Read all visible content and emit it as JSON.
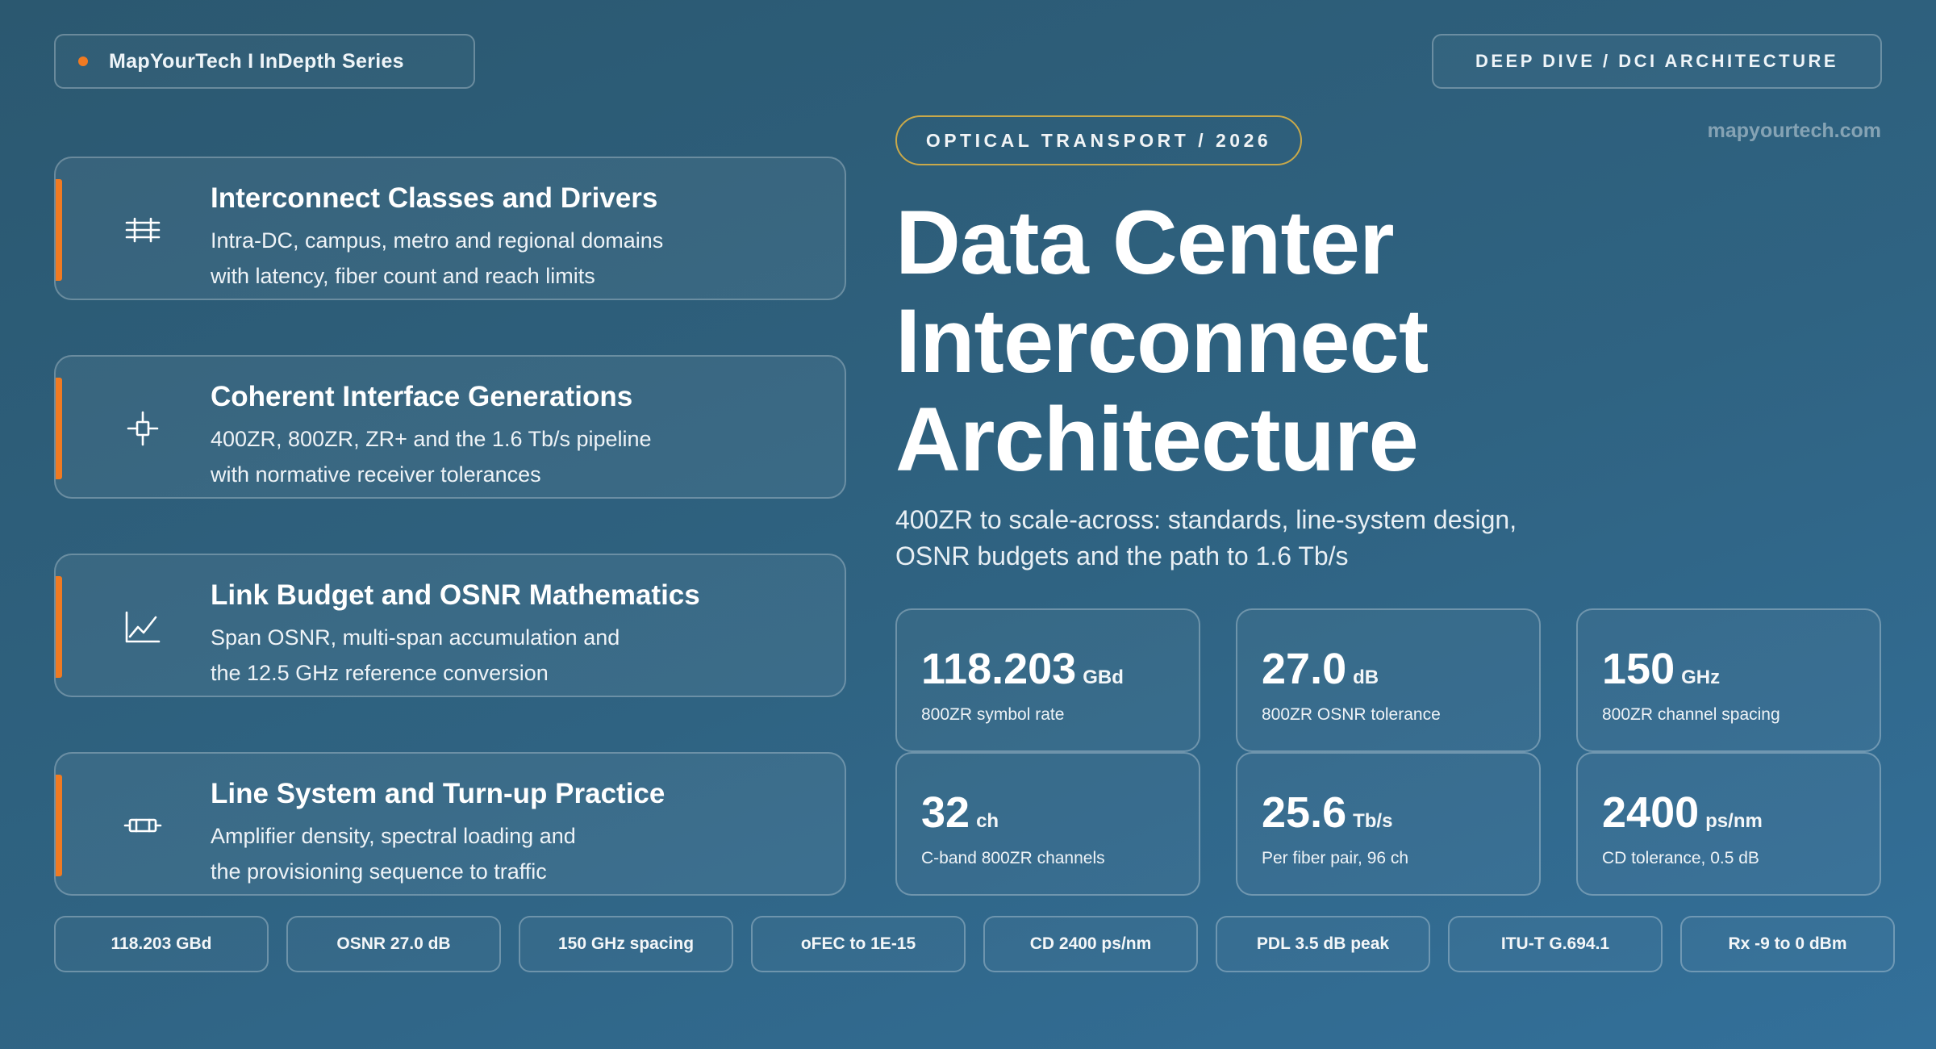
{
  "brand": {
    "label": "MapYourTech I InDepth Series"
  },
  "section_tag": "DEEP DIVE / DCI ARCHITECTURE",
  "site_url": "mapyourtech.com",
  "eyebrow": "OPTICAL TRANSPORT / 2026",
  "title": {
    "line1": "Data Center",
    "line2": "Interconnect",
    "line3": "Architecture"
  },
  "subtitle": {
    "line1": "400ZR to scale-across: standards, line-system design,",
    "line2": "OSNR budgets and the path to 1.6 Tb/s"
  },
  "cards": [
    {
      "icon": "grid-icon",
      "title": "Interconnect Classes and Drivers",
      "desc1": "Intra-DC, campus, metro and regional domains",
      "desc2": "with latency, fiber count and reach limits"
    },
    {
      "icon": "crosshair-icon",
      "title": "Coherent Interface Generations",
      "desc1": "400ZR, 800ZR, ZR+ and the 1.6 Tb/s pipeline",
      "desc2": "with normative receiver tolerances"
    },
    {
      "icon": "line-chart-icon",
      "title": "Link Budget and OSNR Mathematics",
      "desc1": "Span OSNR, multi-span accumulation and",
      "desc2": "the 12.5 GHz reference conversion"
    },
    {
      "icon": "amplifier-icon",
      "title": "Line System and Turn-up Practice",
      "desc1": "Amplifier density, spectral loading and",
      "desc2": "the provisioning sequence to traffic"
    }
  ],
  "stats": [
    {
      "value": "118.203",
      "unit": "GBd",
      "label": "800ZR symbol rate"
    },
    {
      "value": "27.0",
      "unit": "dB",
      "label": "800ZR OSNR tolerance"
    },
    {
      "value": "150",
      "unit": "GHz",
      "label": "800ZR channel spacing"
    },
    {
      "value": "32",
      "unit": "ch",
      "label": "C-band 800ZR channels"
    },
    {
      "value": "25.6",
      "unit": "Tb/s",
      "label": "Per fiber pair, 96 ch"
    },
    {
      "value": "2400",
      "unit": "ps/nm",
      "label": "CD tolerance, 0.5 dB"
    }
  ],
  "chips": [
    "118.203 GBd",
    "OSNR 27.0 dB",
    "150 GHz spacing",
    "oFEC to 1E-15",
    "CD 2400 ps/nm",
    "PDL 3.5 dB peak",
    "ITU-T G.694.1",
    "Rx -9 to 0 dBm"
  ],
  "colors": {
    "accent": "#f07a22",
    "eyebrow_border": "#c9a94a",
    "background": "#2f6382"
  }
}
